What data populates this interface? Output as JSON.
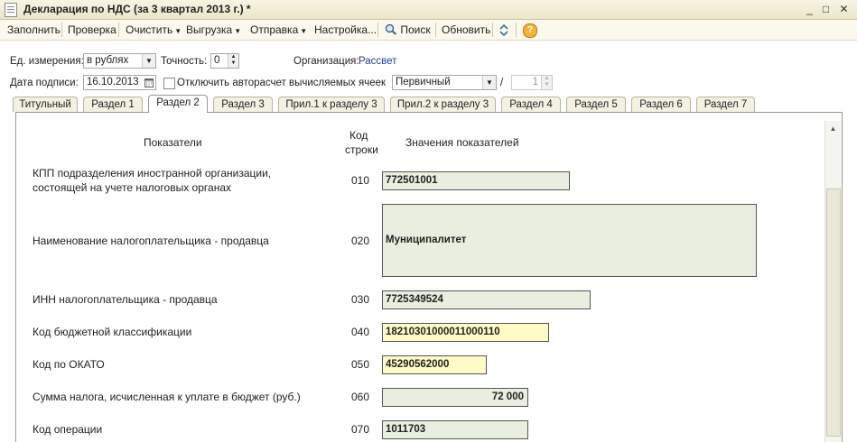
{
  "window": {
    "title": "Декларация по НДС (за 3 квартал 2013 г.) *",
    "min": "_",
    "max": "□",
    "close": "✕"
  },
  "toolbar": {
    "fill": "Заполнить",
    "check": "Проверка",
    "clear": "Очистить",
    "export": "Выгрузка",
    "send": "Отправка",
    "settings": "Настройка...",
    "search": "Поиск",
    "refresh": "Обновить",
    "help": "?"
  },
  "form": {
    "unit_label": "Ед. измерения:",
    "unit_value": "в рублях",
    "precision_label": "Точность:",
    "precision_value": "0",
    "org_label": "Организация:",
    "org_value": "Рассвет",
    "date_label": "Дата подписи:",
    "date_value": "16.10.2013",
    "autocalc_label": "Отключить авторасчет вычисляемых ячеек",
    "type_value": "Первичный",
    "slash": "/",
    "correction_value": "1"
  },
  "tabs": [
    "Титульный",
    "Раздел 1",
    "Раздел 2",
    "Раздел 3",
    "Прил.1 к разделу 3",
    "Прил.2 к разделу 3",
    "Раздел 4",
    "Раздел 5",
    "Раздел 6",
    "Раздел 7"
  ],
  "table": {
    "col_indicators": "Показатели",
    "col_code_1": "Код",
    "col_code_2": "строки",
    "col_values": "Значения показателей",
    "rows": [
      {
        "label_1": "КПП подразделения иностранной организации,",
        "label_2": "состоящей на учете налоговых органах",
        "code": "010",
        "value": "772501001"
      },
      {
        "label_1": "Наименование налогоплательщика - продавца",
        "code": "020",
        "value": "Муниципалитет"
      },
      {
        "label_1": "ИНН налогоплательщика - продавца",
        "code": "030",
        "value": "7725349524"
      },
      {
        "label_1": "Код бюджетной классификации",
        "code": "040",
        "value": "18210301000011000110"
      },
      {
        "label_1": "Код по ОКАТО",
        "code": "050",
        "value": "45290562000"
      },
      {
        "label_1": "Сумма налога, исчисленная к уплате в бюджет (руб.)",
        "code": "060",
        "value": "72 000"
      },
      {
        "label_1": "Код операции",
        "code": "070",
        "value": "1011703"
      }
    ]
  },
  "colors": {
    "field_green": "#e8eee0",
    "field_yellow": "#fefbc6",
    "link_blue": "#1f3f9f"
  }
}
